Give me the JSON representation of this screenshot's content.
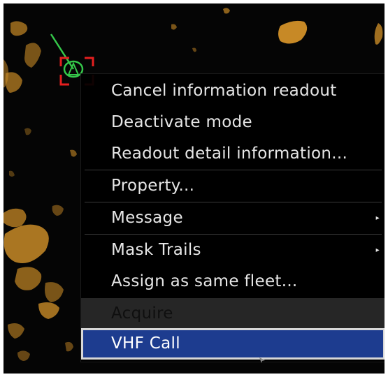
{
  "context_menu": {
    "items": [
      {
        "label": "Cancel information readout",
        "state": "normal"
      },
      {
        "label": "Deactivate mode",
        "state": "normal"
      },
      {
        "label": "Readout detail information...",
        "state": "normal"
      },
      {
        "label": "Property...",
        "state": "normal"
      },
      {
        "label": "Message",
        "state": "normal",
        "has_submenu": true
      },
      {
        "label": "Mask Trails",
        "state": "normal",
        "has_submenu": true
      },
      {
        "label": "Assign as same fleet...",
        "state": "normal"
      },
      {
        "label": "Acquire",
        "state": "disabled"
      },
      {
        "label": "VHF Call",
        "state": "selected"
      }
    ],
    "submenu_arrow_glyph": "▸"
  },
  "colors": {
    "radar_background": "#050505",
    "radar_echo": "#d9962a",
    "target_vector": "#35c84a",
    "target_bracket": "#e51f1f",
    "menu_background": "#000000",
    "menu_text": "#e6e6e6",
    "selected_background": "#1d3c8f",
    "disabled_background": "#262626"
  },
  "icons": {
    "target_symbol": "tracked-target-icon",
    "pointer": "mouse-cursor-icon"
  }
}
